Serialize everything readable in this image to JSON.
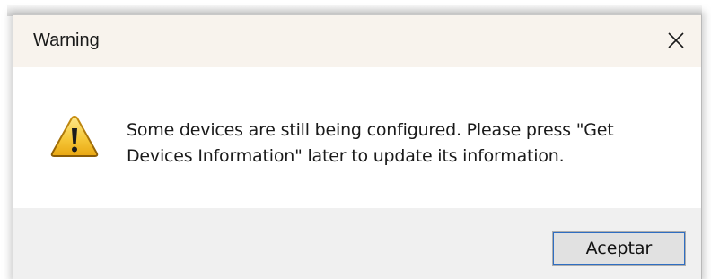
{
  "dialog": {
    "title": "Warning",
    "message": "Some devices are still being configured. Please press \"Get Devices Information\" later to update its information.",
    "icon": "warning-icon",
    "close_icon": "close-icon",
    "ok_label": "Aceptar"
  },
  "colors": {
    "titlebar_bg": "#f8f3ed",
    "footer_bg": "#f0f0f0",
    "button_bg": "#e1e1e1",
    "button_focus": "#2f6ec2"
  }
}
